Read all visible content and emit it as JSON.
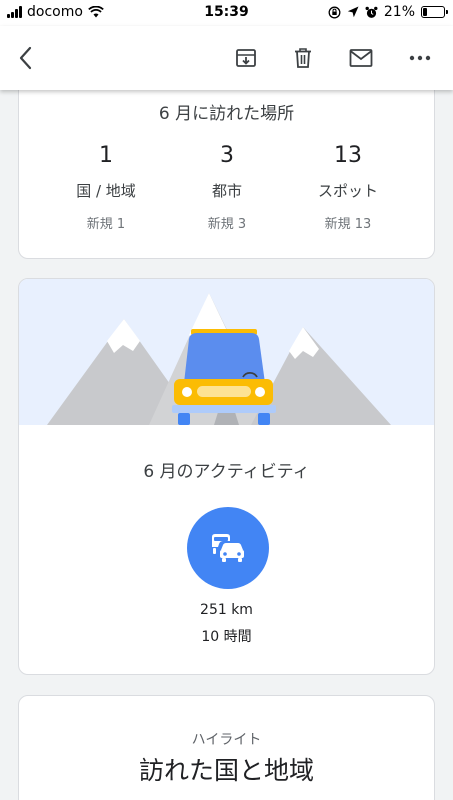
{
  "status_bar": {
    "carrier": "docomo",
    "time": "15:39",
    "battery_percent": "21%",
    "battery_level": 0.21
  },
  "toolbar": {
    "back_icon": "chevron-left-icon",
    "archive_icon": "archive-icon",
    "delete_icon": "trash-icon",
    "mail_icon": "mail-icon",
    "more_icon": "more-horizontal-icon"
  },
  "places_card": {
    "title": "6 月に訪れた場所",
    "stats": [
      {
        "value": "1",
        "label": "国 / 地域",
        "new": "新規 1"
      },
      {
        "value": "3",
        "label": "都市",
        "new": "新規 3"
      },
      {
        "value": "13",
        "label": "スポット",
        "new": "新規 13"
      }
    ]
  },
  "activity_card": {
    "title": "6 月のアクティビティ",
    "icon": "driving-icon",
    "distance": "251 km",
    "duration": "10 時間"
  },
  "highlight_card": {
    "label": "ハイライト",
    "title": "訪れた国と地域"
  },
  "colors": {
    "accent_blue": "#4285f4",
    "car_yellow": "#fbbc04",
    "sky": "#e8f0fe"
  }
}
